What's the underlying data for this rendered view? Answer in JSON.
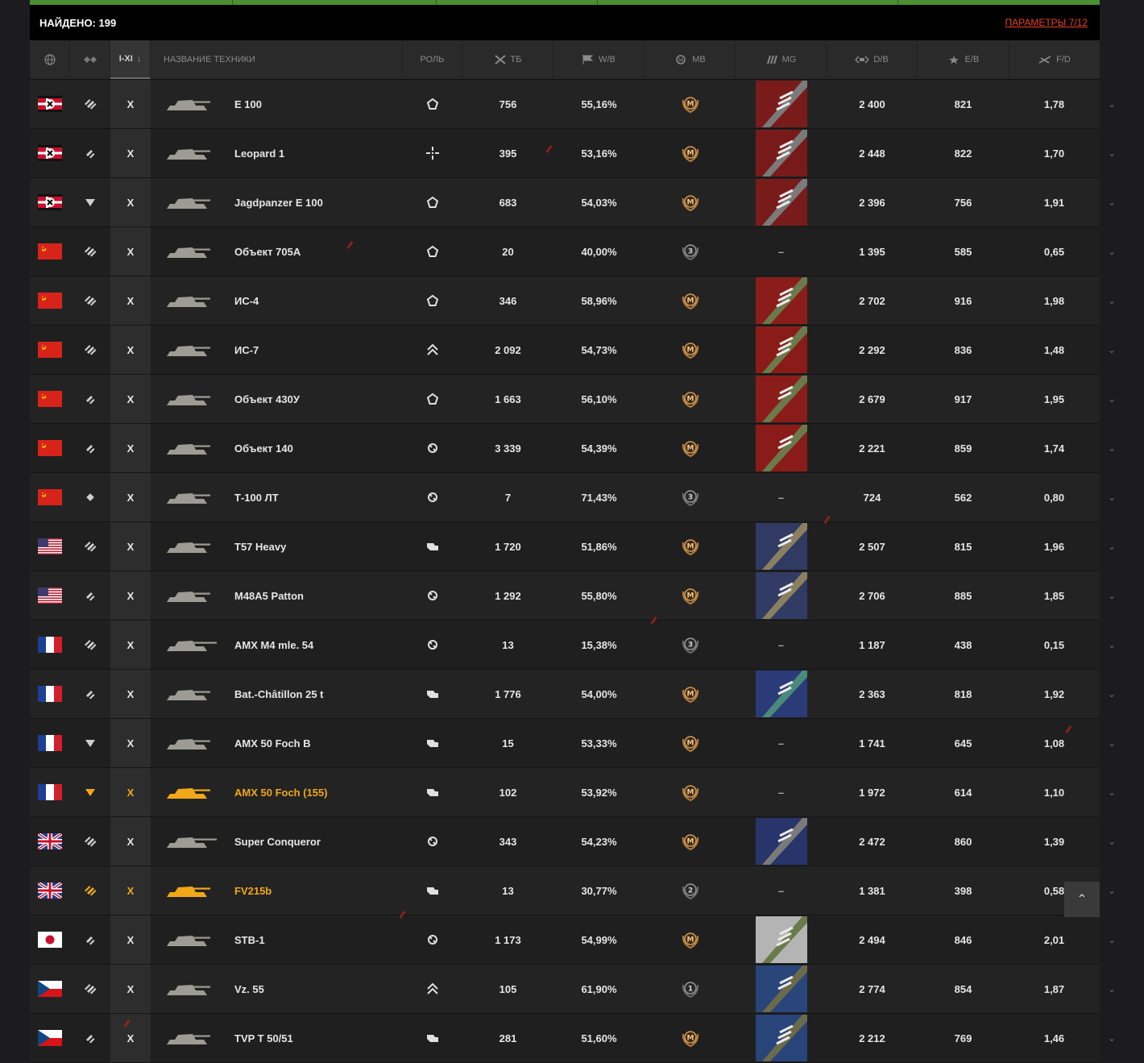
{
  "found": {
    "label": "НАЙДЕНО: 199",
    "params_link": "ПАРАМЕТРЫ 7/12"
  },
  "headers": {
    "nation_icon": "globe-icon",
    "type_icon": "vehicle-type-icon",
    "tier": "I-XI",
    "tier_sort": "↓",
    "name": "НАЗВАНИЕ ТЕХНИКИ",
    "role": "РОЛЬ",
    "battles": "ТБ",
    "winrate": "W/B",
    "mastery": "MB",
    "marks": "MG",
    "damage": "D/B",
    "exp": "E/B",
    "frags": "F/D"
  },
  "colors": {
    "accent_green": "#4b8f32",
    "premium": "#f0a818",
    "link_red": "#e8402a"
  },
  "rows": [
    {
      "nation": "germany",
      "type": "heavy",
      "tier": "X",
      "name": "E 100",
      "role": "heavy-assault",
      "battles": "756",
      "winrate": "55,16%",
      "mastery": "M",
      "marks": "germany-3",
      "damage": "2 400",
      "exp": "821",
      "frags": "1,78",
      "premium": false
    },
    {
      "nation": "germany",
      "type": "medium",
      "tier": "X",
      "name": "Leopard 1",
      "role": "sniper",
      "battles": "395",
      "winrate": "53,16%",
      "mastery": "M",
      "marks": "germany-3",
      "damage": "2 448",
      "exp": "822",
      "frags": "1,70",
      "premium": false
    },
    {
      "nation": "germany",
      "type": "td",
      "tier": "X",
      "name": "Jagdpanzer E 100",
      "role": "heavy-assault",
      "battles": "683",
      "winrate": "54,03%",
      "mastery": "M",
      "marks": "germany-3",
      "damage": "2 396",
      "exp": "756",
      "frags": "1,91",
      "premium": false
    },
    {
      "nation": "ussr",
      "type": "heavy",
      "tier": "X",
      "name": "Объект 705А",
      "role": "heavy-assault",
      "battles": "20",
      "winrate": "40,00%",
      "mastery": "3",
      "marks": "–",
      "damage": "1 395",
      "exp": "585",
      "frags": "0,65",
      "premium": false
    },
    {
      "nation": "ussr",
      "type": "heavy",
      "tier": "X",
      "name": "ИС-4",
      "role": "heavy-assault",
      "battles": "346",
      "winrate": "58,96%",
      "mastery": "M",
      "marks": "ussr-3",
      "damage": "2 702",
      "exp": "916",
      "frags": "1,98",
      "premium": false
    },
    {
      "nation": "ussr",
      "type": "heavy",
      "tier": "X",
      "name": "ИС-7",
      "role": "break-through",
      "battles": "2 092",
      "winrate": "54,73%",
      "mastery": "M",
      "marks": "ussr-3",
      "damage": "2 292",
      "exp": "836",
      "frags": "1,48",
      "premium": false
    },
    {
      "nation": "ussr",
      "type": "medium",
      "tier": "X",
      "name": "Объект 430У",
      "role": "heavy-assault",
      "battles": "1 663",
      "winrate": "56,10%",
      "mastery": "M",
      "marks": "ussr-2",
      "damage": "2 679",
      "exp": "917",
      "frags": "1,95",
      "premium": false
    },
    {
      "nation": "ussr",
      "type": "medium",
      "tier": "X",
      "name": "Объект 140",
      "role": "universal",
      "battles": "3 339",
      "winrate": "54,39%",
      "mastery": "M",
      "marks": "ussr-2",
      "damage": "2 221",
      "exp": "859",
      "frags": "1,74",
      "premium": false
    },
    {
      "nation": "ussr",
      "type": "light",
      "tier": "X",
      "name": "Т-100 ЛТ",
      "role": "universal",
      "battles": "7",
      "winrate": "71,43%",
      "mastery": "3",
      "marks": "–",
      "damage": "724",
      "exp": "562",
      "frags": "0,80",
      "premium": false
    },
    {
      "nation": "usa",
      "type": "heavy",
      "tier": "X",
      "name": "T57 Heavy",
      "role": "support",
      "battles": "1 720",
      "winrate": "51,86%",
      "mastery": "M",
      "marks": "usa-2",
      "damage": "2 507",
      "exp": "815",
      "frags": "1,96",
      "premium": false
    },
    {
      "nation": "usa",
      "type": "medium",
      "tier": "X",
      "name": "M48A5 Patton",
      "role": "universal",
      "battles": "1 292",
      "winrate": "55,80%",
      "mastery": "M",
      "marks": "usa-2",
      "damage": "2 706",
      "exp": "885",
      "frags": "1,85",
      "premium": false
    },
    {
      "nation": "france",
      "type": "heavy",
      "tier": "X",
      "name": "AMX M4 mle. 54",
      "role": "universal",
      "battles": "13",
      "winrate": "15,38%",
      "mastery": "3",
      "marks": "–",
      "damage": "1 187",
      "exp": "438",
      "frags": "0,15",
      "premium": false
    },
    {
      "nation": "france",
      "type": "medium",
      "tier": "X",
      "name": "Bat.-Châtillon 25 t",
      "role": "support",
      "battles": "1 776",
      "winrate": "54,00%",
      "mastery": "M",
      "marks": "france-2",
      "damage": "2 363",
      "exp": "818",
      "frags": "1,92",
      "premium": false
    },
    {
      "nation": "france",
      "type": "td",
      "tier": "X",
      "name": "AMX 50 Foch B",
      "role": "support",
      "battles": "15",
      "winrate": "53,33%",
      "mastery": "M",
      "marks": "–",
      "damage": "1 741",
      "exp": "645",
      "frags": "1,08",
      "premium": false
    },
    {
      "nation": "france",
      "type": "td",
      "tier": "X",
      "name": "AMX 50 Foch (155)",
      "role": "support",
      "battles": "102",
      "winrate": "53,92%",
      "mastery": "M",
      "marks": "–",
      "damage": "1 972",
      "exp": "614",
      "frags": "1,10",
      "premium": true
    },
    {
      "nation": "uk",
      "type": "heavy",
      "tier": "X",
      "name": "Super Conqueror",
      "role": "universal",
      "battles": "343",
      "winrate": "54,23%",
      "mastery": "M",
      "marks": "uk-2",
      "damage": "2 472",
      "exp": "860",
      "frags": "1,39",
      "premium": false
    },
    {
      "nation": "uk",
      "type": "heavy",
      "tier": "X",
      "name": "FV215b",
      "role": "support",
      "battles": "13",
      "winrate": "30,77%",
      "mastery": "2",
      "marks": "–",
      "damage": "1 381",
      "exp": "398",
      "frags": "0,58",
      "premium": true
    },
    {
      "nation": "japan",
      "type": "medium",
      "tier": "X",
      "name": "STB-1",
      "role": "universal",
      "battles": "1 173",
      "winrate": "54,99%",
      "mastery": "M",
      "marks": "japan-3",
      "damage": "2 494",
      "exp": "846",
      "frags": "2,01",
      "premium": false
    },
    {
      "nation": "czech",
      "type": "heavy",
      "tier": "X",
      "name": "Vz. 55",
      "role": "break-through",
      "battles": "105",
      "winrate": "61,90%",
      "mastery": "1",
      "marks": "czech-2",
      "damage": "2 774",
      "exp": "854",
      "frags": "1,87",
      "premium": false
    },
    {
      "nation": "czech",
      "type": "medium",
      "tier": "X",
      "name": "TVP T 50/51",
      "role": "support",
      "battles": "281",
      "winrate": "51,60%",
      "mastery": "M",
      "marks": "czech-3",
      "damage": "2 212",
      "exp": "769",
      "frags": "1,46",
      "premium": false
    }
  ],
  "scroll_top_icon": "double-chevron-up-icon",
  "expand_icon": "chevron-down-icon"
}
